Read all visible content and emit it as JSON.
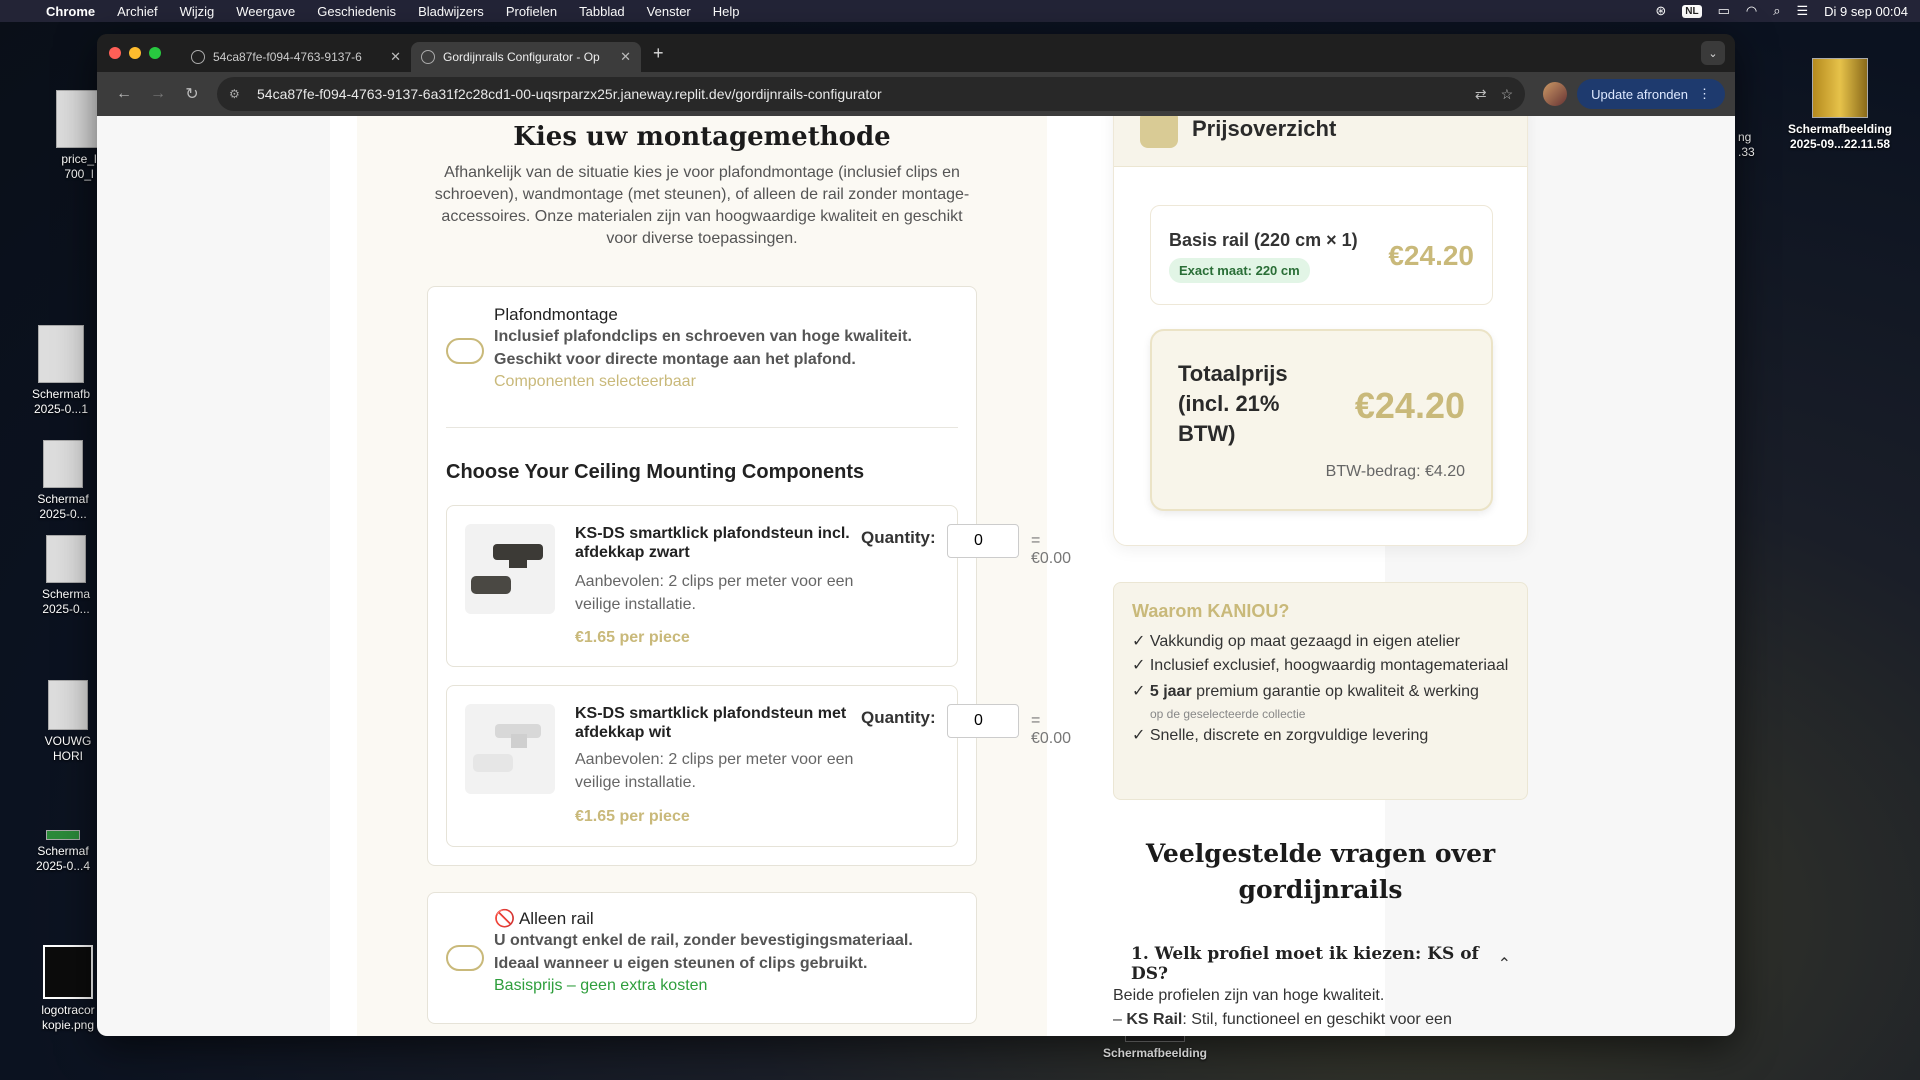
{
  "menubar": {
    "app": "Chrome",
    "items": [
      "Archief",
      "Wijzig",
      "Weergave",
      "Geschiedenis",
      "Bladwijzers",
      "Profielen",
      "Tabblad",
      "Venster",
      "Help"
    ],
    "lang": "NL",
    "datetime": "Di 9 sep  00:04"
  },
  "desktop": {
    "icons": [
      {
        "label": "price_l\n700_l"
      },
      {
        "label": "Schermafb\n2025-0...1"
      },
      {
        "label": "Schermaf\n2025-0..."
      },
      {
        "label": "Scherma\n2025-0..."
      },
      {
        "label": "VOUWG\nHORI"
      },
      {
        "label": "Schermaf\n2025-0...4"
      },
      {
        "label": "logotracor\nkopie.png"
      },
      {
        "label": "ng\n.33"
      },
      {
        "label": "Schermafbeelding\n2025-09...22.11.58"
      },
      {
        "label": "Schermafbeelding"
      }
    ]
  },
  "browser": {
    "tabs": [
      {
        "title": "54ca87fe-f094-4763-9137-6"
      },
      {
        "title": "Gordijnrails Configurator - Op"
      }
    ],
    "url": "54ca87fe-f094-4763-9137-6a31f2c28cd1-00-uqsrparzx25r.janeway.replit.dev/gordijnrails-configurator",
    "update_label": "Update afronden"
  },
  "configurator": {
    "heading": "Kies uw montagemethode",
    "intro": "Afhankelijk van de situatie kies je voor plafondmontage (inclusief clips en schroeven), wandmontage (met steunen), of alleen de rail zonder montage-accessoires. Onze materialen zijn van hoogwaardige kwaliteit en geschikt voor diverse toepassingen.",
    "option_ceiling": {
      "title": "Plafondmontage",
      "desc": "Inclusief plafondclips en schroeven van hoge kwaliteit. Geschikt voor directe montage aan het plafond.",
      "note": "Componenten selecteerbaar"
    },
    "components_heading": "Choose Your Ceiling Mounting Components",
    "components": [
      {
        "name": "KS-DS smartklick plafondsteun incl. afdekkap zwart",
        "desc": "Aanbevolen: 2 clips per meter voor een veilige installatie.",
        "price": "€1.65 per piece",
        "qty_label": "Quantity:",
        "qty": "0",
        "subtotal": "= €0.00"
      },
      {
        "name": "KS-DS smartklick plafondsteun met afdekkap wit",
        "desc": "Aanbevolen: 2 clips per meter voor een veilige installatie.",
        "price": "€1.65 per piece",
        "qty_label": "Quantity:",
        "qty": "0",
        "subtotal": "= €0.00"
      }
    ],
    "option_rail": {
      "icon": "🚫",
      "title": "Alleen rail",
      "desc": "U ontvangt enkel de rail, zonder bevestigingsmateriaal. Ideaal wanneer u eigen steunen of clips gebruikt.",
      "note": "Basisprijs – geen extra kosten"
    }
  },
  "summary": {
    "title": "Prijsoverzicht",
    "base_label": "Basis rail (220 cm × 1)",
    "base_badge": "Exact maat: 220 cm",
    "base_price": "€24.20",
    "total_label": "Totaalprijs (incl. 21% BTW)",
    "total_price": "€24.20",
    "vat": "BTW-bedrag: €4.20"
  },
  "why": {
    "title": "Waarom KANIOU?",
    "items": [
      "✓ Vakkundig op maat gezaagd in eigen atelier",
      "✓ Inclusief exclusief, hoogwaardig montagemateriaal",
      "✓",
      "5 jaar",
      "premium garantie op kwaliteit & werking",
      "op de geselecteerde collectie",
      "✓ Snelle, discrete en zorgvuldige levering"
    ]
  },
  "faq": {
    "heading": "Veelgestelde vragen over gordijnrails",
    "q1": "1. Welk profiel moet ik kiezen: KS of DS?",
    "a1_line1": "Beide profielen zijn van hoge kwaliteit.",
    "a1_bold": "KS Rail",
    "a1_line2": ": Stil, functioneel en geschikt voor een"
  },
  "colors": {
    "accent_gold": "#c9b97a",
    "green": "#2e9e3c",
    "badge_bg": "#e2f5e6"
  }
}
